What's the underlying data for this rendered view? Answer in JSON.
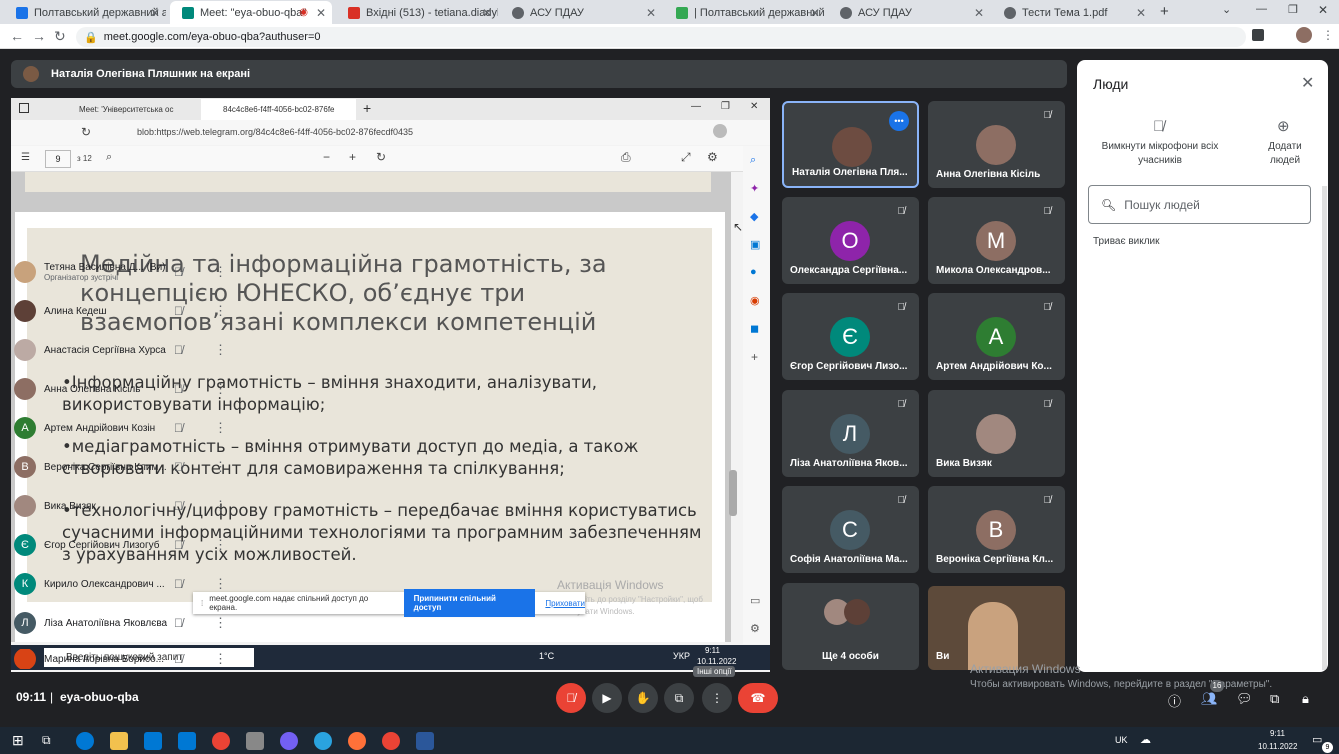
{
  "browser_tabs": [
    {
      "title": "Полтавський державний аграр",
      "color": "#1a73e8",
      "active": false
    },
    {
      "title": "Meet: \"eya-obuo-qba\"",
      "color": "#00897b",
      "active": true
    },
    {
      "title": "Вхідні (513) - tetiana.diadyk@p",
      "color": "#d93025",
      "active": false
    },
    {
      "title": "АСУ ПДАУ",
      "color": "#5f6368",
      "active": false
    },
    {
      "title": "| Полтавський державний агра",
      "color": "#34a853",
      "active": false
    },
    {
      "title": "АСУ ПДАУ",
      "color": "#5f6368",
      "active": false
    },
    {
      "title": "Тести Тема 1.pdf",
      "color": "#5f6368",
      "active": false
    }
  ],
  "address": "meet.google.com/eya-obuo-qba?authuser=0",
  "presenter_banner": "Наталія Олегівна Пляшник на екрані",
  "shared_screen": {
    "edge_tabs": [
      "Meet: 'Університетська ос",
      "84c4c8e6-f4ff-4056-bc02-876fe"
    ],
    "edge_url": "blob:https://web.telegram.org/84c4c8e6-f4ff-4056-bc02-876fecdf0435",
    "page_num": "9",
    "page_total": "з 12",
    "slide_title": "Медійна та інформаційна грамотність, за концепцією ЮНЕСКО, об’єднує три взаємопов’язані комплекси компетенцій",
    "bullets": [
      "•Інформаційну грамотність – вміння знаходити, аналізувати, використовувати інформацію;",
      "•медіаграмотність – вміння отримувати доступ до медіа, а також створювати контент для самовираження та спілкування;",
      "•технологічну/цифрову грамотність – передбачає вміння користуватись сучасними інформаційними технологіями та програмним забезпеченням з урахуванням усіх можливостей."
    ],
    "share_text": "meet.google.com надає спільний доступ до екрана.",
    "share_stop": "Припинити спільний доступ",
    "share_hide": "Приховати",
    "activation": "Активація Windows",
    "activation_sub": "Перейдіть до розділу \"Настройки\", щоб активувати Windows.",
    "taskbar_search": "Введіть пошуковий запит",
    "taskbar_temp": "1°C",
    "taskbar_lang": "УКР",
    "taskbar_time": "9:11",
    "taskbar_date": "10.11.2022"
  },
  "tiles": [
    {
      "name": "Наталія Олегівна Пля...",
      "letter": "",
      "color": "#6d4c41",
      "mute": "•••"
    },
    {
      "name": "Анна Олегівна Кісіль",
      "letter": "",
      "color": "#8d6e63",
      "mute": "🎤̸"
    },
    {
      "name": "Олександра Сергіївна...",
      "letter": "О",
      "color": "#8e24aa",
      "mute": "🎤̸"
    },
    {
      "name": "Микола Олександров...",
      "letter": "М",
      "color": "#8d6e63",
      "mute": "🎤̸"
    },
    {
      "name": "Єгор Сергійович Лизо...",
      "letter": "Є",
      "color": "#00897b",
      "mute": "🎤̸"
    },
    {
      "name": "Артем Андрійович Ко...",
      "letter": "А",
      "color": "#2e7d32",
      "mute": "🎤̸"
    },
    {
      "name": "Ліза Анатоліївна Яков...",
      "letter": "Л",
      "color": "#455a64",
      "mute": "🎤̸"
    },
    {
      "name": "Вика Визяк",
      "letter": "",
      "color": "#a1887f",
      "mute": "🎤̸"
    },
    {
      "name": "Софія Анатоліївна Ма...",
      "letter": "С",
      "color": "#455a64",
      "mute": "🎤̸"
    },
    {
      "name": "Вероніка Сергіївна Кл...",
      "letter": "В",
      "color": "#8d6e63",
      "mute": "🎤̸"
    },
    {
      "name": "Ще 4 особи",
      "letter": "",
      "color": "#5f6368",
      "mute": ""
    },
    {
      "name": "Ви",
      "letter": "",
      "color": "#6d4c41",
      "mute": ""
    }
  ],
  "people_panel": {
    "title": "Люди",
    "mute_all": "Вимкнути мікрофони всіх учасників",
    "add_people": "Додати людей",
    "search_placeholder": "Пошук людей",
    "section": "Триває виклик",
    "list": [
      {
        "name": "Тетяна Василівна Д... (Ви)",
        "sub": "Організатор зустрічі",
        "letter": "",
        "color": "#c8a27c"
      },
      {
        "name": "Алина Кедеш",
        "sub": "",
        "letter": "",
        "color": "#5d4037"
      },
      {
        "name": "Анастасія Сергіївна Хурса",
        "sub": "",
        "letter": "",
        "color": "#bcaaa4"
      },
      {
        "name": "Анна Олегівна Кісіль",
        "sub": "",
        "letter": "",
        "color": "#8d6e63"
      },
      {
        "name": "Артем Андрійович Козін",
        "sub": "",
        "letter": "А",
        "color": "#2e7d32"
      },
      {
        "name": "Вероніка Сергіївна Клим...",
        "sub": "",
        "letter": "В",
        "color": "#8d6e63"
      },
      {
        "name": "Вика Визяк",
        "sub": "",
        "letter": "",
        "color": "#a1887f"
      },
      {
        "name": "Єгор Сергійович Лизогуб",
        "sub": "",
        "letter": "Є",
        "color": "#00897b"
      },
      {
        "name": "Кирило Олександрович ...",
        "sub": "",
        "letter": "К",
        "color": "#00897b"
      },
      {
        "name": "Ліза Анатоліївна Яковлєва",
        "sub": "",
        "letter": "Л",
        "color": "#455a64"
      },
      {
        "name": "Марина Ігорівна Борисо...",
        "sub": "",
        "letter": "",
        "color": "#d84315"
      }
    ]
  },
  "meeting": {
    "time": "09:11",
    "code": "eya-obuo-qba",
    "tooltip": "Інші опції",
    "participants_badge": "16"
  },
  "activation_overlay": {
    "title": "Активация Windows",
    "sub": "Чтобы активировать Windows, перейдите в раздел \"Параметры\"."
  },
  "win_taskbar": {
    "lang": "UK",
    "time": "9:11",
    "date": "10.11.2022",
    "badge": "9"
  }
}
